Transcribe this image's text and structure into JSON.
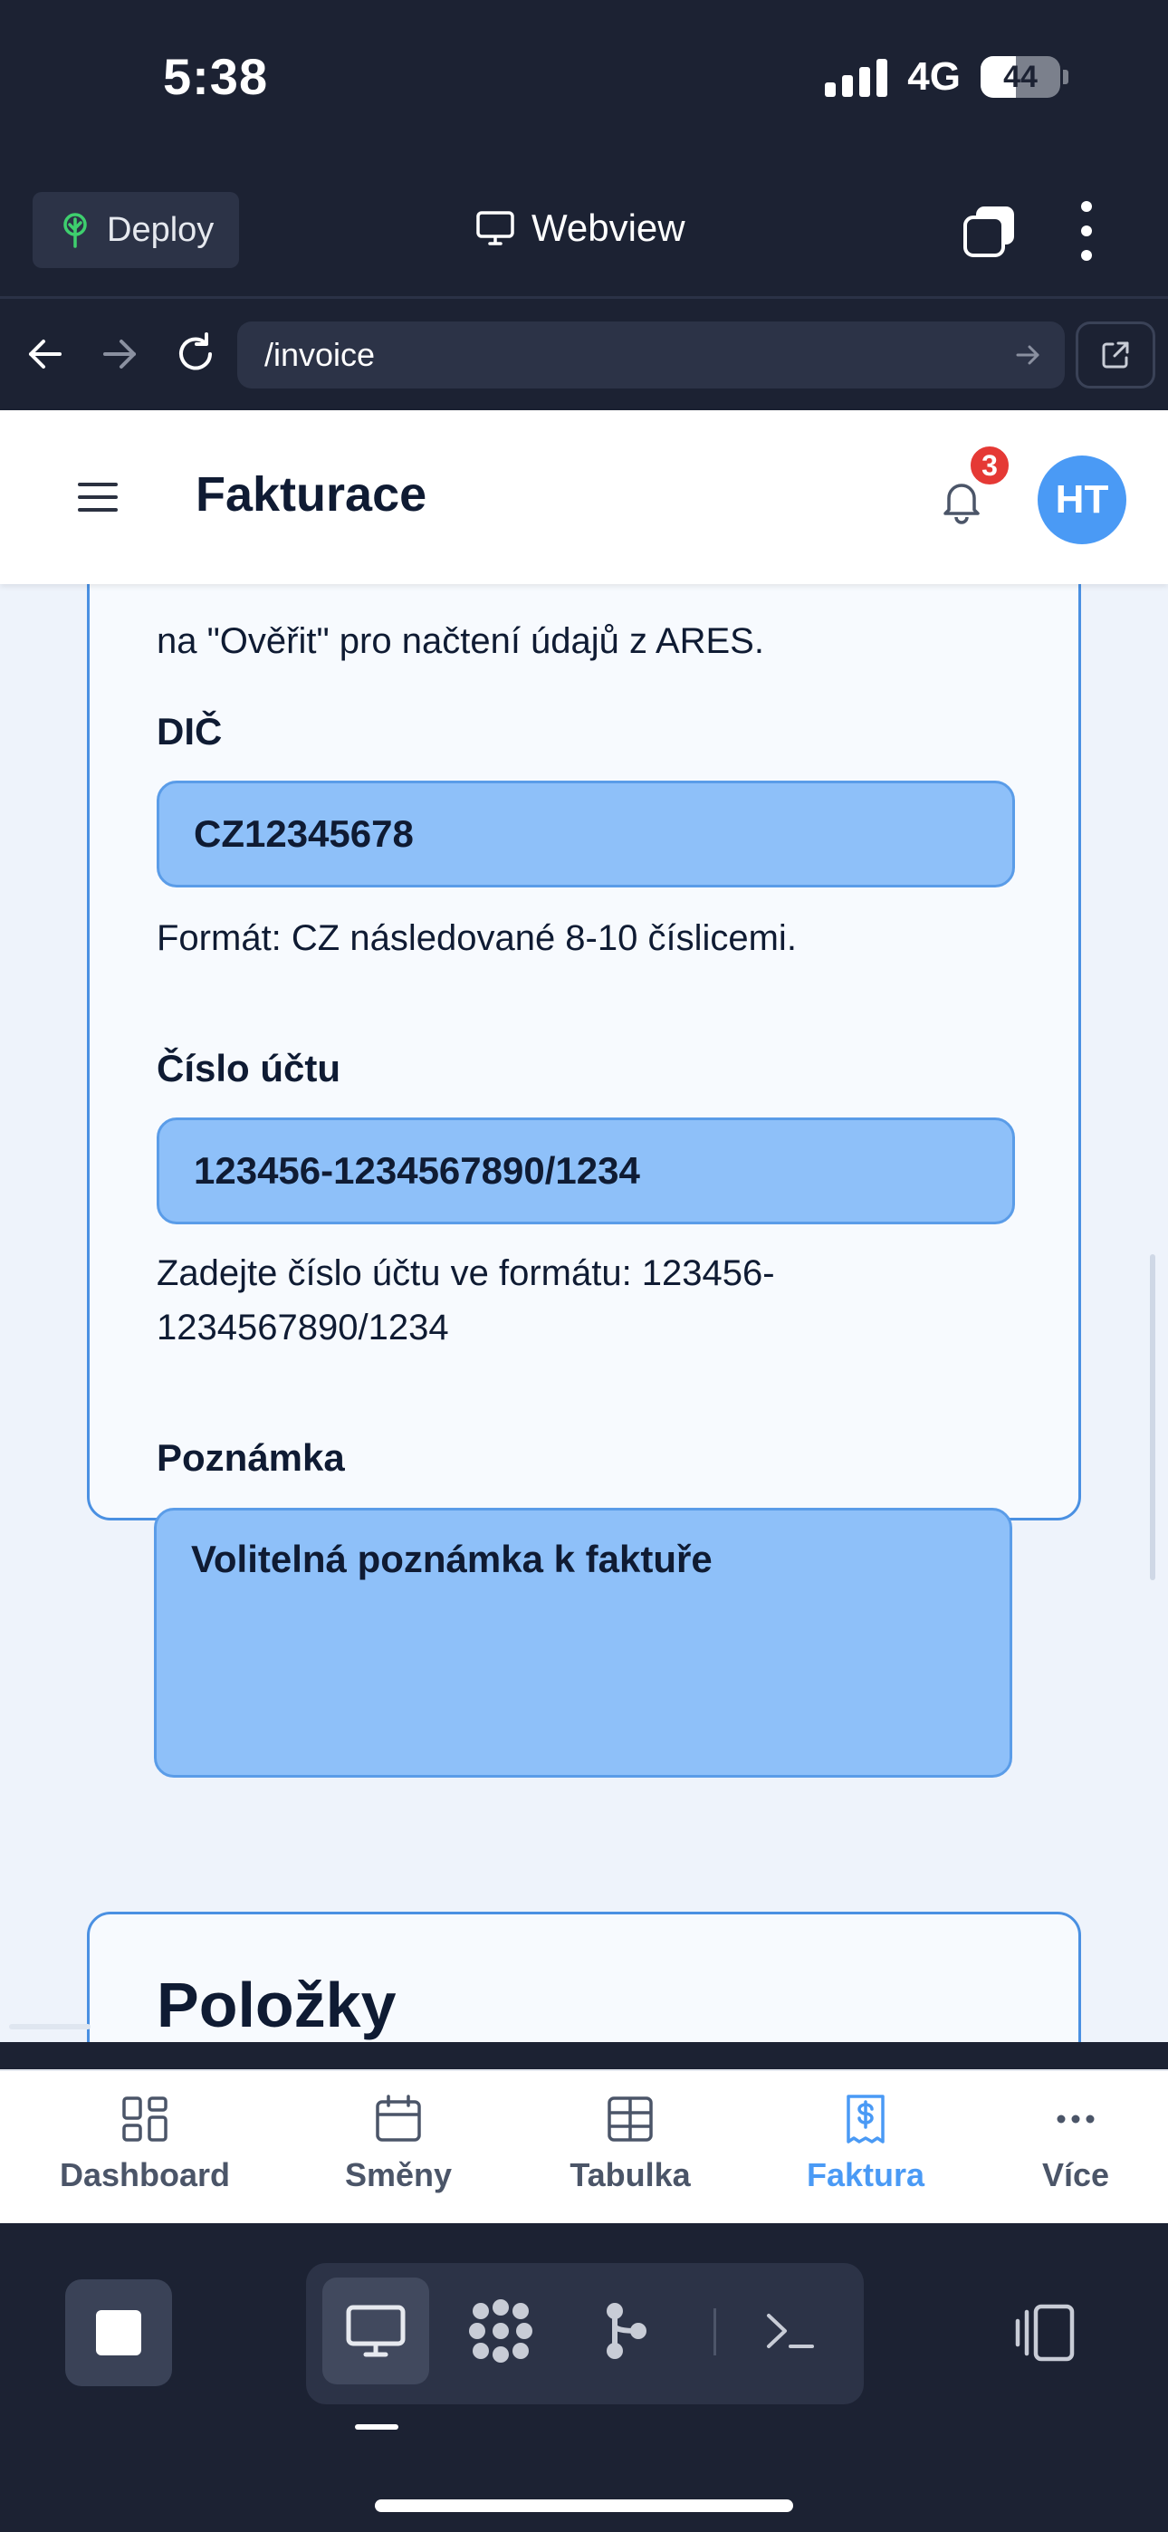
{
  "status_bar": {
    "time": "5:38",
    "network": "4G",
    "battery": "44",
    "battery_level": 0.44
  },
  "toolbar": {
    "deploy_label": "Deploy",
    "title": "Webview"
  },
  "urlbar": {
    "url": "/invoice"
  },
  "header": {
    "title": "Fakturace",
    "notification_count": "3",
    "avatar_initials": "HT"
  },
  "form": {
    "ares_hint": "na \"Ověřit\" pro načtení údajů z ARES.",
    "dic": {
      "label": "DIČ",
      "value": "CZ12345678",
      "hint": "Formát: CZ následované 8-10 číslicemi."
    },
    "account": {
      "label": "Číslo účtu",
      "value": "123456-1234567890/1234",
      "hint_line1": "Zadejte číslo účtu ve formátu: 123456-",
      "hint_line2": "1234567890/1234"
    },
    "note": {
      "label": "Poznámka",
      "placeholder": "Volitelná poznámka k faktuře"
    }
  },
  "items_section": {
    "title": "Položky"
  },
  "tabs": [
    {
      "label": "Dashboard",
      "icon": "dashboard-icon"
    },
    {
      "label": "Směny",
      "icon": "calendar-icon"
    },
    {
      "label": "Tabulka",
      "icon": "table-icon"
    },
    {
      "label": "Faktura",
      "icon": "invoice-icon",
      "active": true
    },
    {
      "label": "Více",
      "icon": "more-horizontal-icon"
    }
  ],
  "colors": {
    "accent": "#4a9af5",
    "field_bg": "#8ec0f9",
    "card_border": "#4a90e2",
    "dark_chrome": "#1c2233",
    "badge": "#e53935"
  }
}
